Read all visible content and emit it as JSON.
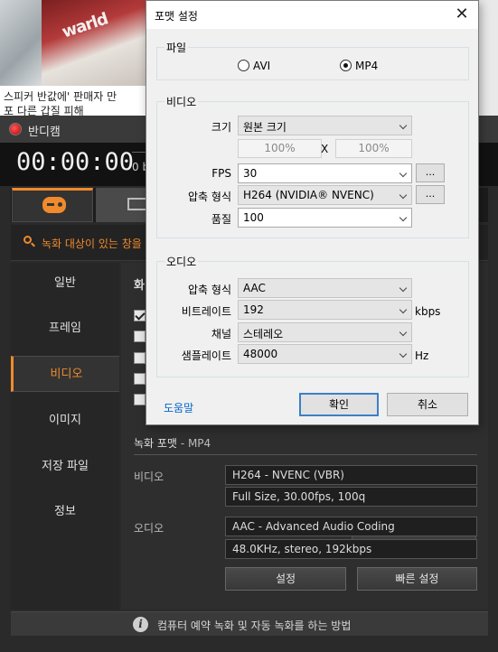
{
  "background_page": {
    "photo_sign": "warld",
    "headline_line1": "스피커 반값에' 판매자 만",
    "headline_line2": "포 다른 갑질 피해"
  },
  "bandicam": {
    "title": "반디캠",
    "timer": "00:00:00",
    "size_fragment": "0 b",
    "target_text": "녹화 대상이 있는 창을",
    "sidebar": [
      {
        "label": "일반"
      },
      {
        "label": "프레임"
      },
      {
        "label": "비디오"
      },
      {
        "label": "이미지"
      },
      {
        "label": "저장 파일"
      },
      {
        "label": "정보"
      }
    ],
    "section_title_fragment": "화",
    "record_format_label": "녹화 포맷",
    "record_format_value": "- MP4",
    "video_label": "비디오",
    "video_line1": "H264 - NVENC (VBR)",
    "video_line2": "Full Size, 30.00fps, 100q",
    "audio_label": "오디오",
    "audio_line1": "AAC - Advanced Audio Coding",
    "audio_line2": "48.0KHz, stereo, 192kbps",
    "settings_button": "설정",
    "quick_settings_button": "빠른 설정",
    "footer_text": "컴퓨터 예약 녹화 및 자동 녹화를 하는 방법",
    "accent_color": "#f08a2c"
  },
  "dialog": {
    "title": "포맷 설정",
    "close_glyph": "✕",
    "file_group_label": "파일",
    "file_options": [
      {
        "label": "AVI",
        "selected": false
      },
      {
        "label": "MP4",
        "selected": true
      }
    ],
    "video_group_label": "비디오",
    "size_label": "크기",
    "size_value": "원본 크기",
    "width_value": "100%",
    "x_sep": "X",
    "height_value": "100%",
    "fps_label": "FPS",
    "fps_value": "30",
    "codec_label": "압축 형식",
    "codec_value": "H264 (NVIDIA® NVENC)",
    "quality_label": "품질",
    "quality_value": "100",
    "dots_label": "...",
    "audio_group_label": "오디오",
    "audio_codec_label": "압축 형식",
    "audio_codec_value": "AAC",
    "bitrate_label": "비트레이트",
    "bitrate_value": "192",
    "bitrate_unit": "kbps",
    "channel_label": "채널",
    "channel_value": "스테레오",
    "samplerate_label": "샘플레이트",
    "samplerate_value": "48000",
    "samplerate_unit": "Hz",
    "help_link": "도움말",
    "ok_button": "확인",
    "cancel_button": "취소"
  }
}
